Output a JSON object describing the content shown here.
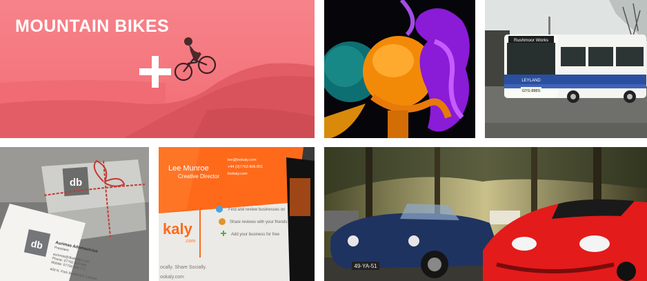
{
  "gallery": {
    "featured": {
      "title": "MOUNTAIN BIKES",
      "overlay_color": "#f0616b",
      "icon": "plus-icon"
    },
    "bus": {
      "destination": "Rushmoor Works",
      "brand": "LEYLAND",
      "registration": "GTG 888S"
    },
    "giftbox": {
      "logo": "db",
      "name": "Aurimas Adomavicius",
      "role": "President",
      "email": "aurimas@dbdesign.com",
      "phone": "Phone: 07700 900 840",
      "mobile": "Mobile: 07700 900 771",
      "address": "400 N. Park Boulevard, London"
    },
    "card": {
      "name": "Lee Munroe",
      "title": "Creative Director",
      "email": "lee@lookaly.com",
      "phone": "+44 (0)7763 806 861",
      "site": "lookaly.com",
      "feature_1": "Find and review businesses on",
      "feature_2": "Share reviews with your friends",
      "feature_3": "Add your business for free",
      "brand": "kaly",
      "brand_suffix": ".com",
      "tagline": "ocally. Share Socially.",
      "url": "ookaly.com",
      "accent": "#ff6a1a"
    },
    "cars": {
      "plate": "49-YA-51"
    }
  }
}
